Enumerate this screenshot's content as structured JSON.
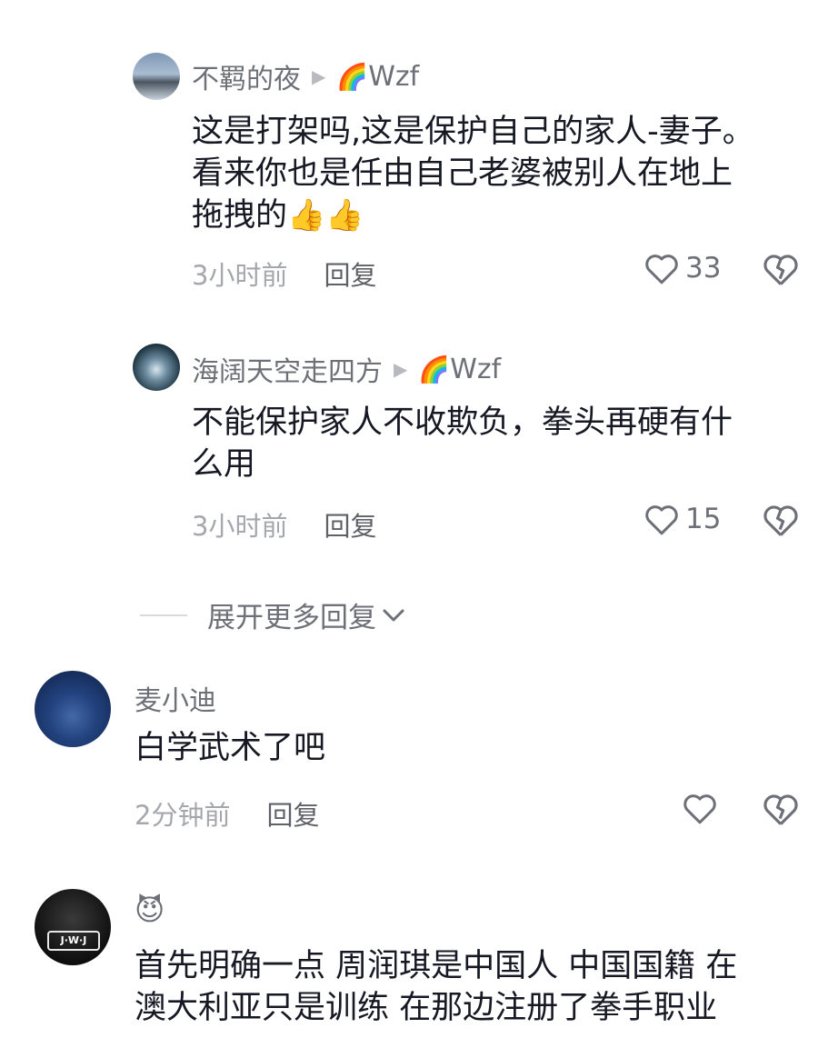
{
  "colors": {
    "text": "#161823",
    "secondary": "#6e7078",
    "muted": "#a5a7ad"
  },
  "replies": [
    {
      "author": "不羁的夜",
      "reply_to": "Wzf",
      "text_lines": [
        "这是打架吗,这是保护自己的家人-妻子。",
        "看来你也是任由自己老婆被别人在地上",
        "拖拽的"
      ],
      "emoji": "👍👍",
      "time": "3小时前",
      "reply_label": "回复",
      "likes": "33"
    },
    {
      "author": "海阔天空走四方",
      "reply_to": "Wzf",
      "text_lines": [
        "不能保护家人不收欺负，拳头再硬有什",
        "么用"
      ],
      "time": "3小时前",
      "reply_label": "回复",
      "likes": "15"
    }
  ],
  "expand_label": "展开更多回复",
  "comments": [
    {
      "author": "麦小迪",
      "text_lines": [
        "白学武术了吧"
      ],
      "time": "2分钟前",
      "reply_label": "回复"
    },
    {
      "author_emoji": "😈",
      "text_lines": [
        "首先明确一点 周润琪是中国人 中国国籍 在",
        "澳大利亚只是训练 在那边注册了拳手职业"
      ]
    }
  ]
}
